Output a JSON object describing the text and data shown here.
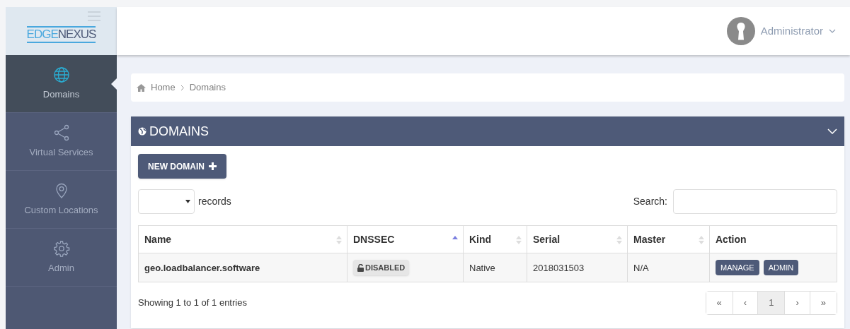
{
  "logo": {
    "parts": [
      "EDGE",
      "NEXUS"
    ]
  },
  "user": {
    "name": "Administrator"
  },
  "sidebar": {
    "items": [
      {
        "label": "Domains",
        "selected": true
      },
      {
        "label": "Virtual Services",
        "selected": false
      },
      {
        "label": "Custom Locations",
        "selected": false
      },
      {
        "label": "Admin",
        "selected": false
      }
    ]
  },
  "breadcrumb": [
    "Home",
    "Domains"
  ],
  "panel": {
    "title": "DOMAINS",
    "new_button": "NEW DOMAIN",
    "records_label": "records",
    "search_label": "Search:"
  },
  "table": {
    "columns": [
      {
        "label": "Name",
        "sortable": true,
        "sorted": false
      },
      {
        "label": "DNSSEC",
        "sortable": true,
        "sorted": true
      },
      {
        "label": "Kind",
        "sortable": true,
        "sorted": false
      },
      {
        "label": "Serial",
        "sortable": true,
        "sorted": false
      },
      {
        "label": "Master",
        "sortable": true,
        "sorted": false
      },
      {
        "label": "Action",
        "sortable": false,
        "sorted": false
      }
    ],
    "rows": [
      {
        "name": "geo.loadbalancer.software",
        "dnssec": "DISABLED",
        "kind": "Native",
        "serial": "2018031503",
        "master": "N/A",
        "actions": [
          "MANAGE",
          "ADMIN"
        ]
      }
    ]
  },
  "info": "Showing 1 to 1 of 1 entries",
  "pagination": [
    {
      "label": "«",
      "selected": false
    },
    {
      "label": "‹",
      "selected": false
    },
    {
      "label": "1",
      "selected": true
    },
    {
      "label": "›",
      "selected": false
    },
    {
      "label": "»",
      "selected": false
    }
  ]
}
